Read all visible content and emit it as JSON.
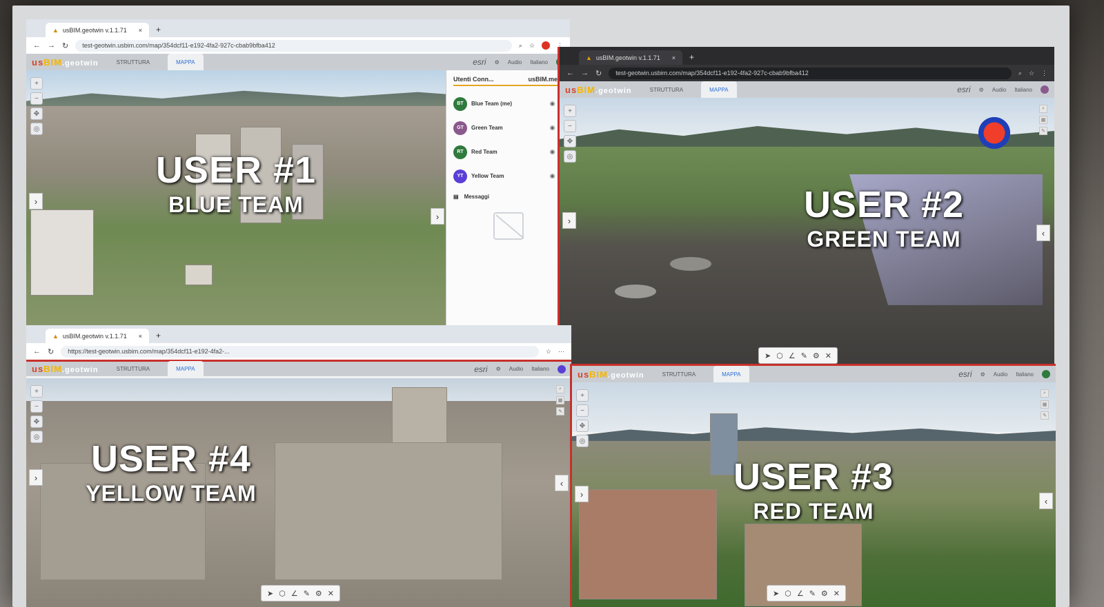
{
  "panes": {
    "user1": {
      "tab_title": "usBIM.geotwin v.1.1.71",
      "url": "test-geotwin.usbim.com/map/354dcf11-e192-4fa2-927c-cbab9bfba412",
      "overlay_user": "USER #1",
      "overlay_team": "BLUE TEAM",
      "users_panel": {
        "title": "Utenti Conn...",
        "brand": "usBIM.meet",
        "members": [
          {
            "initials": "BT",
            "name": "Blue Team (me)",
            "color": "#2f7a3d"
          },
          {
            "initials": "GT",
            "name": "Green Team",
            "color": "#8a5a8c"
          },
          {
            "initials": "RT",
            "name": "Red Team",
            "color": "#2f7a3d"
          },
          {
            "initials": "YT",
            "name": "Yellow Team",
            "color": "#5a3fd6"
          }
        ],
        "messages_label": "Messaggi"
      }
    },
    "user2": {
      "tab_title": "usBIM.geotwin v.1.1.71",
      "url": "test-geotwin.usbim.com/map/354dcf11-e192-4fa2-927c-cbab9bfba412",
      "overlay_user": "USER #2",
      "overlay_team": "GREEN TEAM"
    },
    "user3": {
      "overlay_user": "USER #3",
      "overlay_team": "RED TEAM"
    },
    "user4": {
      "tab_title": "usBIM.geotwin v.1.1.71",
      "url": "https://test-geotwin.usbim.com/map/354dcf11-e192-4fa2-...",
      "overlay_user": "USER #4",
      "overlay_team": "YELLOW TEAM"
    }
  },
  "app": {
    "logo_us": "us",
    "logo_bim": "BIM",
    "logo_geo": ".geotwin",
    "tab_struttura": "STRUTTURA",
    "tab_mappa": "MAPPA",
    "esri": "esri",
    "audio": "Audio",
    "lang": "Italiano"
  },
  "colors": {
    "divider": "#c8302b",
    "accent": "#2c6fd6",
    "brand_red": "#d6442a",
    "brand_yellow": "#f4b600"
  }
}
